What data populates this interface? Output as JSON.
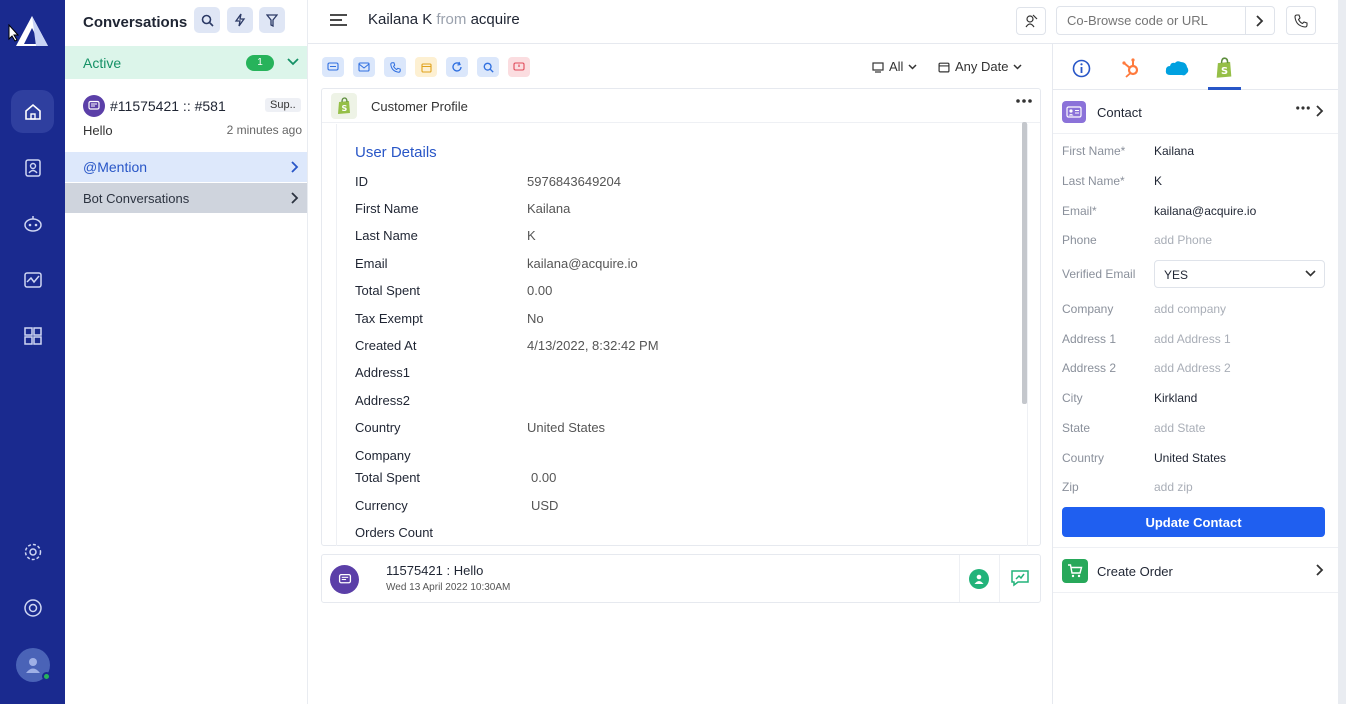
{
  "conversations": {
    "title": "Conversations",
    "active_label": "Active",
    "active_count": "1",
    "item": {
      "title": "#11575421 :: #581",
      "tag": "Sup..",
      "message": "Hello",
      "time": "2 minutes ago"
    },
    "mention_label": "@Mention",
    "bot_label": "Bot Conversations"
  },
  "header": {
    "contact_name": "Kailana K",
    "from_word": "from",
    "company": "acquire",
    "cobrowse_placeholder": "Co-Browse code or URL"
  },
  "filters": {
    "channel": "All",
    "date": "Any Date"
  },
  "profile": {
    "card_title": "Customer Profile",
    "section_title": "User Details",
    "rows": [
      {
        "key": "ID",
        "value": "5976843649204"
      },
      {
        "key": "First Name",
        "value": "Kailana"
      },
      {
        "key": "Last Name",
        "value": "K"
      },
      {
        "key": "Email",
        "value": "kailana@acquire.io"
      },
      {
        "key": "Total Spent",
        "value": "0.00"
      },
      {
        "key": "Tax Exempt",
        "value": "No"
      },
      {
        "key": "Created At",
        "value": "4/13/2022, 8:32:42 PM"
      },
      {
        "key": "Address1",
        "value": ""
      },
      {
        "key": "Address2",
        "value": ""
      },
      {
        "key": "Country",
        "value": "United States"
      },
      {
        "key": "Company",
        "value": ""
      },
      {
        "key": "Total Spent",
        "value": "0.00"
      },
      {
        "key": "Currency",
        "value": "USD"
      },
      {
        "key": "Orders Count",
        "value": ""
      }
    ]
  },
  "message": {
    "title": "11575421 : Hello",
    "time": "Wed 13 April 2022 10:30AM"
  },
  "contact": {
    "title": "Contact",
    "fields": [
      {
        "label": "First Name*",
        "value": "Kailana",
        "placeholder": false
      },
      {
        "label": "Last Name*",
        "value": "K",
        "placeholder": false
      },
      {
        "label": "Email*",
        "value": "kailana@acquire.io",
        "placeholder": false
      },
      {
        "label": "Phone",
        "value": "add Phone",
        "placeholder": true
      }
    ],
    "verified_email_label": "Verified Email",
    "verified_email_value": "YES",
    "fields2": [
      {
        "label": "Company",
        "value": "add company",
        "placeholder": true
      },
      {
        "label": "Address 1",
        "value": "add Address 1",
        "placeholder": true
      },
      {
        "label": "Address 2",
        "value": "add Address 2",
        "placeholder": true
      },
      {
        "label": "City",
        "value": "Kirkland",
        "placeholder": false
      },
      {
        "label": "State",
        "value": "add State",
        "placeholder": true
      },
      {
        "label": "Country",
        "value": "United States",
        "placeholder": false
      },
      {
        "label": "Zip",
        "value": "add zip",
        "placeholder": true
      }
    ],
    "update_label": "Update Contact",
    "create_order_label": "Create Order"
  },
  "icons": {
    "rail": [
      "home-icon",
      "contacts-icon",
      "bot-icon",
      "analytics-icon",
      "apps-icon",
      "settings-icon",
      "support-icon",
      "user-avatar"
    ],
    "tools": [
      "chat-icon",
      "email-icon",
      "phone-icon",
      "calendar-icon",
      "refresh-icon",
      "search-icon",
      "flag-chat-icon"
    ],
    "right_tabs": [
      "info-icon",
      "hubspot-icon",
      "salesforce-icon",
      "shopify-icon"
    ]
  },
  "colors": {
    "rail": "#1a2a8f",
    "accent": "#2856c7",
    "button": "#1f5ff0",
    "active_green": "#27b35b",
    "shopify": "#95bf47",
    "hubspot": "#ff7a3d",
    "salesforce": "#00a1e0"
  }
}
